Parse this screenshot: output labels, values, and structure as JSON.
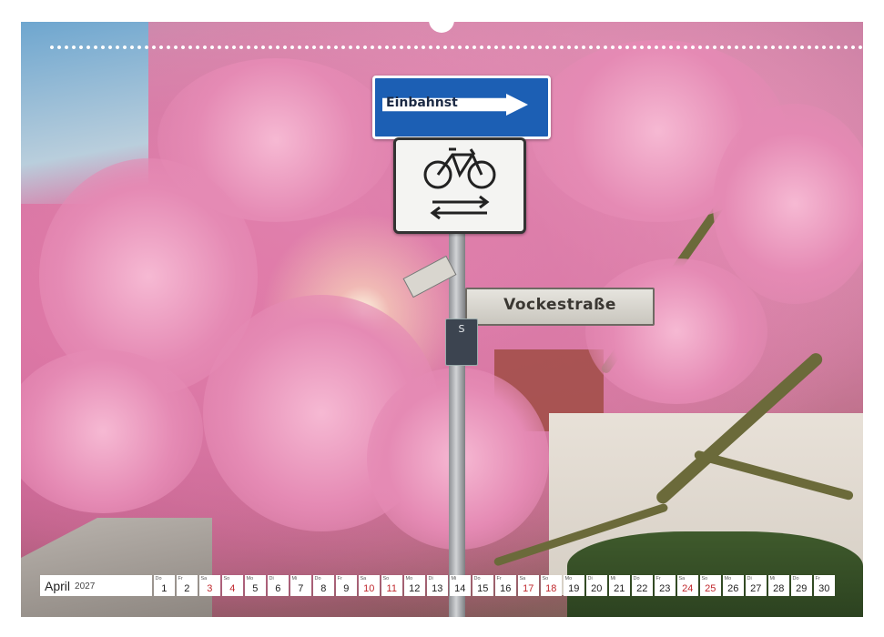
{
  "photo": {
    "description_icon": "magnolia-tree-street-sign-photo"
  },
  "signs": {
    "oneway": "Einbahnst",
    "street": "Vockestraße",
    "small": "S"
  },
  "calendar": {
    "month": "April",
    "year": "2027",
    "days": [
      {
        "wd": "Do",
        "d": "1",
        "hl": false
      },
      {
        "wd": "Fr",
        "d": "2",
        "hl": false
      },
      {
        "wd": "Sa",
        "d": "3",
        "hl": true
      },
      {
        "wd": "So",
        "d": "4",
        "hl": true
      },
      {
        "wd": "Mo",
        "d": "5",
        "hl": false
      },
      {
        "wd": "Di",
        "d": "6",
        "hl": false
      },
      {
        "wd": "Mi",
        "d": "7",
        "hl": false
      },
      {
        "wd": "Do",
        "d": "8",
        "hl": false
      },
      {
        "wd": "Fr",
        "d": "9",
        "hl": false
      },
      {
        "wd": "Sa",
        "d": "10",
        "hl": true
      },
      {
        "wd": "So",
        "d": "11",
        "hl": true
      },
      {
        "wd": "Mo",
        "d": "12",
        "hl": false
      },
      {
        "wd": "Di",
        "d": "13",
        "hl": false
      },
      {
        "wd": "Mi",
        "d": "14",
        "hl": false
      },
      {
        "wd": "Do",
        "d": "15",
        "hl": false
      },
      {
        "wd": "Fr",
        "d": "16",
        "hl": false
      },
      {
        "wd": "Sa",
        "d": "17",
        "hl": true
      },
      {
        "wd": "So",
        "d": "18",
        "hl": true
      },
      {
        "wd": "Mo",
        "d": "19",
        "hl": false
      },
      {
        "wd": "Di",
        "d": "20",
        "hl": false
      },
      {
        "wd": "Mi",
        "d": "21",
        "hl": false
      },
      {
        "wd": "Do",
        "d": "22",
        "hl": false
      },
      {
        "wd": "Fr",
        "d": "23",
        "hl": false
      },
      {
        "wd": "Sa",
        "d": "24",
        "hl": true
      },
      {
        "wd": "So",
        "d": "25",
        "hl": true
      },
      {
        "wd": "Mo",
        "d": "26",
        "hl": false
      },
      {
        "wd": "Di",
        "d": "27",
        "hl": false
      },
      {
        "wd": "Mi",
        "d": "28",
        "hl": false
      },
      {
        "wd": "Do",
        "d": "29",
        "hl": false
      },
      {
        "wd": "Fr",
        "d": "30",
        "hl": false
      }
    ]
  },
  "colors": {
    "weekend": "#c0282d",
    "sign_blue": "#1c5fb4"
  }
}
